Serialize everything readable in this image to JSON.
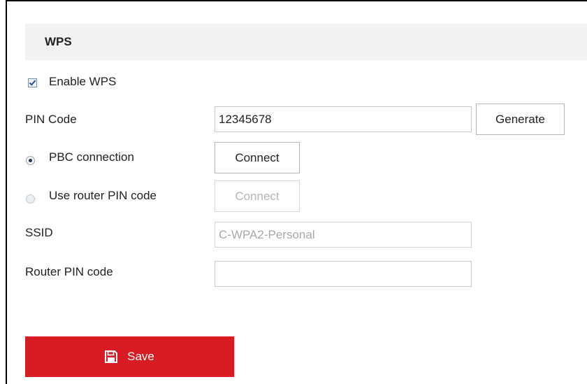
{
  "section": {
    "title": "WPS"
  },
  "enable_wps": {
    "label": "Enable WPS",
    "checked": true
  },
  "pin_code": {
    "label": "PIN Code",
    "value": "12345678",
    "generate_label": "Generate"
  },
  "pbc": {
    "label": "PBC connection",
    "selected": true,
    "connect_label": "Connect"
  },
  "router_pin_option": {
    "label": "Use router PIN code",
    "selected": false,
    "connect_label": "Connect"
  },
  "ssid": {
    "label": "SSID",
    "value": "C-WPA2-Personal"
  },
  "router_pin_code": {
    "label": "Router PIN code",
    "value": ""
  },
  "save": {
    "label": "Save",
    "icon": "floppy-disk-icon"
  },
  "colors": {
    "accent": "#d91c24",
    "header_bg": "#f2f2f2"
  }
}
